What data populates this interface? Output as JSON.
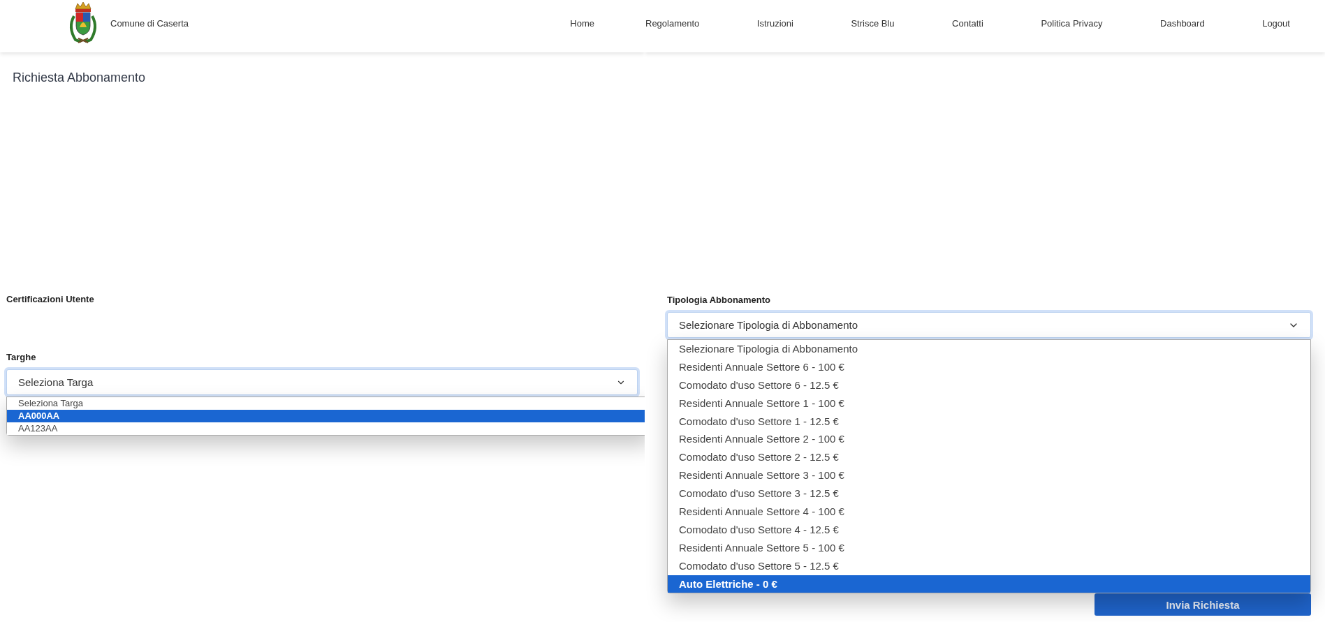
{
  "header": {
    "brand": "Comune di Caserta",
    "nav_left": [
      {
        "label": "Home"
      }
    ],
    "nav_right": [
      {
        "label": "Regolamento"
      },
      {
        "label": "Istruzioni"
      },
      {
        "label": "Strisce Blu"
      },
      {
        "label": "Contatti"
      },
      {
        "label": "Politica Privacy"
      },
      {
        "label": "Dashboard"
      },
      {
        "label": "Logout"
      }
    ]
  },
  "left_panel": {
    "page_title": "Richiesta Abbonamento",
    "certifications_label": "Certificazioni Utente",
    "plates": {
      "label": "Targhe",
      "value": "Seleziona Targa",
      "options": [
        {
          "label": "Seleziona Targa",
          "highlighted": false
        },
        {
          "label": "AA000AA",
          "highlighted": true
        },
        {
          "label": "AA123AA",
          "highlighted": false
        }
      ]
    }
  },
  "right_panel": {
    "subscription_type": {
      "label": "Tipologia Abbonamento",
      "value": "Selezionare Tipologia di Abbonamento",
      "options": [
        {
          "label": "Selezionare Tipologia di Abbonamento",
          "highlighted": false
        },
        {
          "label": "Residenti Annuale Settore 6 - 100 €",
          "highlighted": false
        },
        {
          "label": "Comodato d'uso Settore 6 - 12.5 €",
          "highlighted": false
        },
        {
          "label": "Residenti Annuale Settore 1 - 100 €",
          "highlighted": false
        },
        {
          "label": "Comodato d'uso Settore 1 - 12.5 €",
          "highlighted": false
        },
        {
          "label": "Residenti Annuale Settore 2 - 100 €",
          "highlighted": false
        },
        {
          "label": "Comodato d'uso Settore 2 - 12.5 €",
          "highlighted": false
        },
        {
          "label": "Residenti Annuale Settore 3 - 100 €",
          "highlighted": false
        },
        {
          "label": "Comodato d'uso Settore 3 - 12.5 €",
          "highlighted": false
        },
        {
          "label": "Residenti Annuale Settore 4 - 100 €",
          "highlighted": false
        },
        {
          "label": "Comodato d'uso Settore 4 - 12.5 €",
          "highlighted": false
        },
        {
          "label": "Residenti Annuale Settore 5 - 100 €",
          "highlighted": false
        },
        {
          "label": "Comodato d'uso Settore 5 - 12.5 €",
          "highlighted": false
        },
        {
          "label": "Auto Elettriche - 0 €",
          "highlighted": true
        }
      ]
    },
    "submit_button": "Invia Richiesta"
  }
}
